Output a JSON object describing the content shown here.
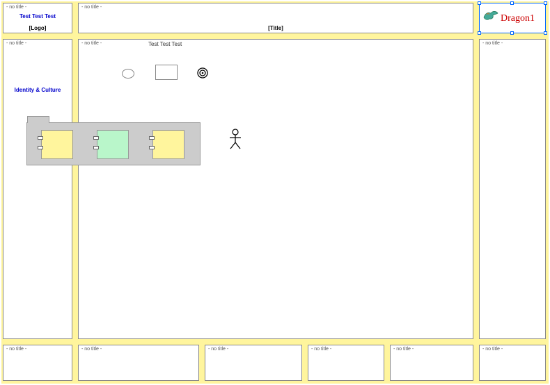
{
  "labels": {
    "no_title": "- no title -",
    "title_placeholder": "[Title]",
    "logo_placeholder": "[Logo]"
  },
  "top_left": {
    "content": "Test Test Test"
  },
  "top_right": {
    "brand": "Dragon1"
  },
  "mid_left": {
    "content": "Identity & Culture"
  },
  "mid_center": {
    "header_text": "Test Test Test"
  },
  "shapes": {
    "ellipse": "ellipse",
    "rect": "rectangle",
    "target": "target-icon",
    "stick": "person-icon"
  },
  "component_group": {
    "boxes": [
      "box1",
      "box2",
      "box3"
    ]
  },
  "colors": {
    "canvas_bg": "#FFF59D",
    "panel_bg": "#ffffff",
    "blue_text": "#0000cc",
    "brand_text": "#cc0000",
    "group_bg": "#cccccc",
    "comp_yellow": "#FFF59D",
    "comp_green": "#B9F6CA",
    "selection": "#0066ff"
  }
}
